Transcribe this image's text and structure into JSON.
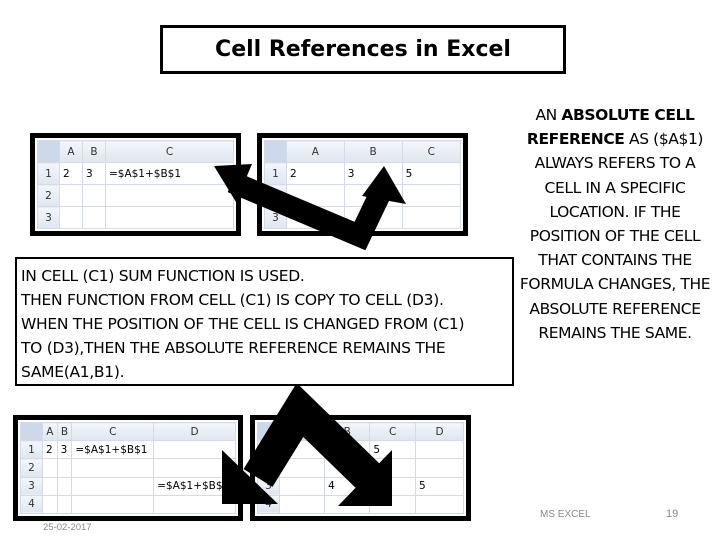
{
  "title": "Cell References in Excel",
  "side_text": {
    "pre": "AN ",
    "bold": "ABSOLUTE CELL REFERENCE",
    "post": " AS ($A$1) ALWAYS REFERS TO A CELL IN A SPECIFIC LOCATION. IF THE POSITION OF THE CELL THAT CONTAINS THE FORMULA CHANGES, THE ABSOLUTE REFERENCE REMAINS THE SAME."
  },
  "note_lines": [
    "IN CELL (C1) SUM FUNCTION IS USED.",
    "THEN FUNCTION FROM CELL (C1) IS COPY TO CELL (D3).",
    "WHEN THE POSITION OF THE CELL IS CHANGED FROM (C1)",
    "TO (D3),THEN THE ABSOLUTE REFERENCE REMAINS THE",
    "SAME(A1,B1)."
  ],
  "sheets": [
    {
      "cols": [
        "A",
        "B",
        "C"
      ],
      "rows": [
        [
          "1",
          "2",
          "3",
          "=$A$1+$B$1"
        ],
        [
          "2",
          "",
          "",
          ""
        ],
        [
          "3",
          "",
          "",
          ""
        ]
      ]
    },
    {
      "cols": [
        "A",
        "B",
        "C"
      ],
      "rows": [
        [
          "1",
          "2",
          "3",
          "5"
        ],
        [
          "2",
          "",
          "",
          ""
        ],
        [
          "3",
          "",
          "",
          ""
        ]
      ]
    },
    {
      "cols": [
        "A",
        "B",
        "C",
        "D"
      ],
      "rows": [
        [
          "1",
          "2",
          "3",
          "=$A$1+$B$1",
          ""
        ],
        [
          "2",
          "",
          "",
          "",
          ""
        ],
        [
          "3",
          "",
          "",
          "",
          "=$A$1+$B$1"
        ],
        [
          "4",
          "",
          "",
          "",
          ""
        ]
      ]
    },
    {
      "cols": [
        "A",
        "B",
        "C",
        "D"
      ],
      "rows": [
        [
          "1",
          "",
          "",
          "5",
          ""
        ],
        [
          "2",
          "",
          "",
          "",
          ""
        ],
        [
          "3",
          "",
          "4",
          "",
          "5"
        ],
        [
          "4",
          "",
          "",
          "",
          ""
        ]
      ]
    }
  ],
  "footer": {
    "date": "25-02-2017",
    "subject": "MS EXCEL",
    "page": "19"
  }
}
